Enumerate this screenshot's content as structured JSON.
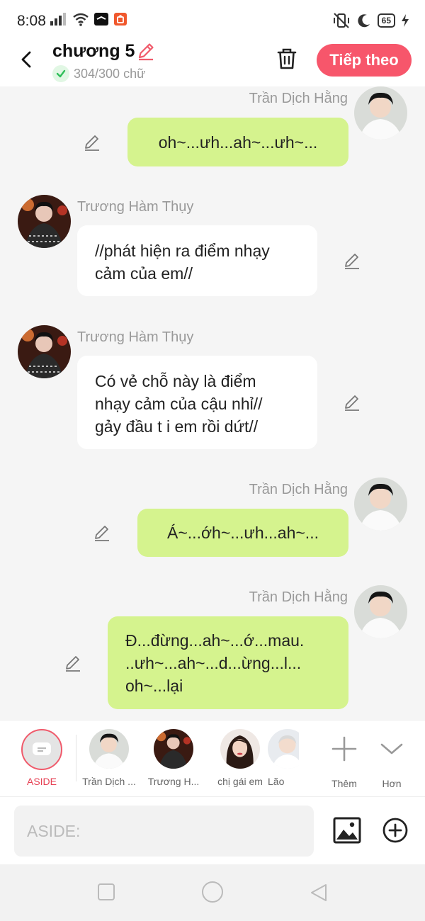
{
  "status": {
    "time": "8:08",
    "battery": "65"
  },
  "header": {
    "chapter_title": "chương 5",
    "word_count": "304/300 chữ",
    "next_label": "Tiếp theo"
  },
  "messages": [
    {
      "side": "right",
      "sender": "Trần Dịch Hằng",
      "lines": [
        "oh~...ưh...ah~...ưh~..."
      ]
    },
    {
      "side": "left",
      "sender": "Trương Hàm Thụy",
      "lines": [
        "//phát hiện ra điểm nhạy",
        "cảm của em//"
      ]
    },
    {
      "side": "left",
      "sender": "Trương Hàm Thụy",
      "lines": [
        "Có vẻ chỗ này là điểm",
        "nhạy cảm của cậu nhỉ//",
        "gảy đầu t i em rồi dứt//"
      ]
    },
    {
      "side": "right",
      "sender": "Trần Dịch Hằng",
      "lines": [
        "Á~...ớh~...ưh...ah~..."
      ]
    },
    {
      "side": "right",
      "sender": "Trần Dịch Hằng",
      "lines": [
        "Đ...đừng...ah~...ớ...mau.",
        "..ưh~...ah~...d...ừng...l...",
        "oh~...lại"
      ]
    }
  ],
  "roles": {
    "aside_label": "ASIDE",
    "items": [
      {
        "label": "Trần Dịch ..."
      },
      {
        "label": "Trương H..."
      },
      {
        "label": "chị gái em"
      },
      {
        "label": "Lão"
      }
    ],
    "more_label": "Thêm",
    "expand_label": "Hơn"
  },
  "input": {
    "placeholder": "ASIDE:"
  },
  "colors": {
    "accent": "#f7566b",
    "right_bubble": "#d5f38e",
    "left_bubble": "#ffffff",
    "background": "#f5f5f5"
  }
}
